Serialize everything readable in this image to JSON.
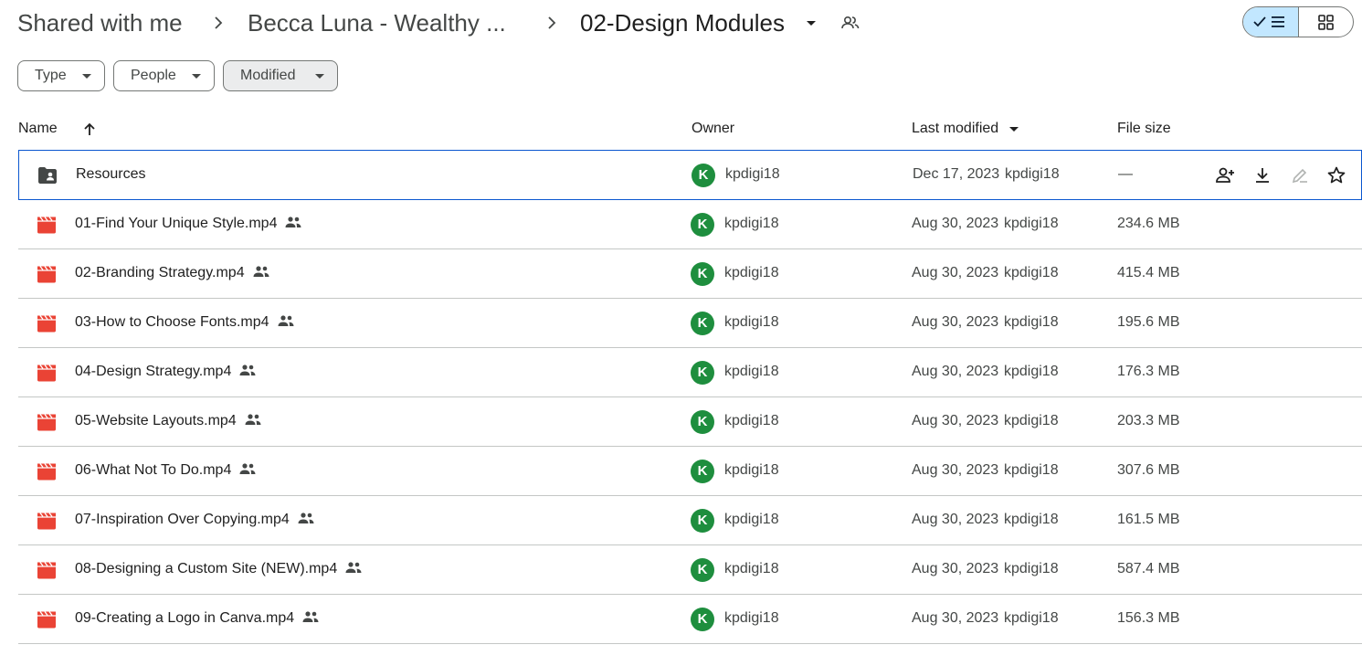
{
  "breadcrumb": {
    "root": "Shared with me",
    "parent": "Becca Luna - Wealthy ...",
    "current": "02-Design Modules"
  },
  "filters": {
    "type": "Type",
    "people": "People",
    "modified": "Modified"
  },
  "columns": {
    "name": "Name",
    "owner": "Owner",
    "last_modified": "Last modified",
    "file_size": "File size"
  },
  "rows": [
    {
      "name": "Resources",
      "kind": "shared-folder",
      "shared": false,
      "avatar": "K",
      "owner": "kpdigi18",
      "date": "Dec 17, 2023",
      "modified_by": "kpdigi18",
      "size": "—"
    },
    {
      "name": "01-Find Your Unique Style.mp4",
      "kind": "video",
      "shared": true,
      "avatar": "K",
      "owner": "kpdigi18",
      "date": "Aug 30, 2023",
      "modified_by": "kpdigi18",
      "size": "234.6 MB"
    },
    {
      "name": "02-Branding Strategy.mp4",
      "kind": "video",
      "shared": true,
      "avatar": "K",
      "owner": "kpdigi18",
      "date": "Aug 30, 2023",
      "modified_by": "kpdigi18",
      "size": "415.4 MB"
    },
    {
      "name": "03-How to Choose Fonts.mp4",
      "kind": "video",
      "shared": true,
      "avatar": "K",
      "owner": "kpdigi18",
      "date": "Aug 30, 2023",
      "modified_by": "kpdigi18",
      "size": "195.6 MB"
    },
    {
      "name": "04-Design Strategy.mp4",
      "kind": "video",
      "shared": true,
      "avatar": "K",
      "owner": "kpdigi18",
      "date": "Aug 30, 2023",
      "modified_by": "kpdigi18",
      "size": "176.3 MB"
    },
    {
      "name": "05-Website Layouts.mp4",
      "kind": "video",
      "shared": true,
      "avatar": "K",
      "owner": "kpdigi18",
      "date": "Aug 30, 2023",
      "modified_by": "kpdigi18",
      "size": "203.3 MB"
    },
    {
      "name": "06-What Not To Do.mp4",
      "kind": "video",
      "shared": true,
      "avatar": "K",
      "owner": "kpdigi18",
      "date": "Aug 30, 2023",
      "modified_by": "kpdigi18",
      "size": "307.6 MB"
    },
    {
      "name": "07-Inspiration Over Copying.mp4",
      "kind": "video",
      "shared": true,
      "avatar": "K",
      "owner": "kpdigi18",
      "date": "Aug 30, 2023",
      "modified_by": "kpdigi18",
      "size": "161.5 MB"
    },
    {
      "name": "08-Designing a Custom Site (NEW).mp4",
      "kind": "video",
      "shared": true,
      "avatar": "K",
      "owner": "kpdigi18",
      "date": "Aug 30, 2023",
      "modified_by": "kpdigi18",
      "size": "587.4 MB"
    },
    {
      "name": "09-Creating a Logo in Canva.mp4",
      "kind": "video",
      "shared": true,
      "avatar": "K",
      "owner": "kpdigi18",
      "date": "Aug 30, 2023",
      "modified_by": "kpdigi18",
      "size": "156.3 MB"
    }
  ],
  "colors": {
    "video_icon": "#ea4335",
    "folder_icon": "#444746",
    "avatar_bg": "#1e8e3e",
    "selected_border": "#0b57d0",
    "view_toggle_active": "#c2e7ff"
  },
  "icons": {
    "view_list": "checkmark-list-icon",
    "view_grid": "grid-icon",
    "row_actions": [
      "share-person-add-icon",
      "download-icon",
      "rename-edit-icon",
      "star-icon"
    ]
  }
}
